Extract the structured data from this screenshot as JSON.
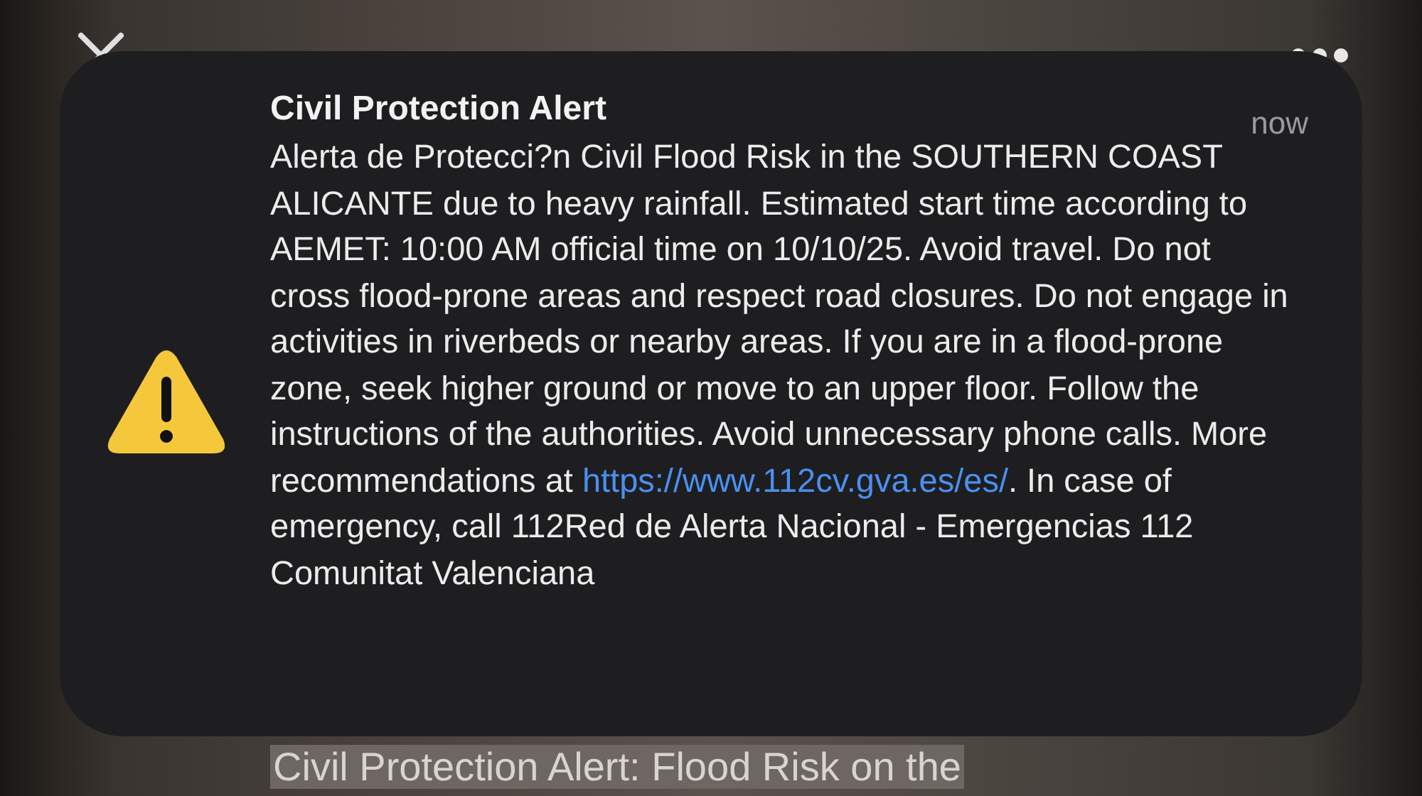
{
  "notification": {
    "title": "Civil Protection Alert",
    "time": "now",
    "body_before": "Alerta de Protecci?n Civil Flood Risk in the SOUTHERN COAST ALICANTE due to heavy rainfall. Estimated start time according to AEMET: 10:00 AM official time on 10/10/25. Avoid travel. Do not cross flood-prone areas and respect road closures. Do not engage in activities in riverbeds or nearby areas. If you are in a flood-prone zone, seek higher ground or move to an upper floor. Follow the instructions of the authorities. Avoid unnecessary phone calls. More recommendations at ",
    "link": "https://www.112cv.gva.es/es/",
    "body_after": ". In case of emergency, call 112Red de Alerta Nacional - Emergencias 112 Comunitat Valenciana"
  },
  "caption": "Civil Protection Alert: Flood Risk on the"
}
